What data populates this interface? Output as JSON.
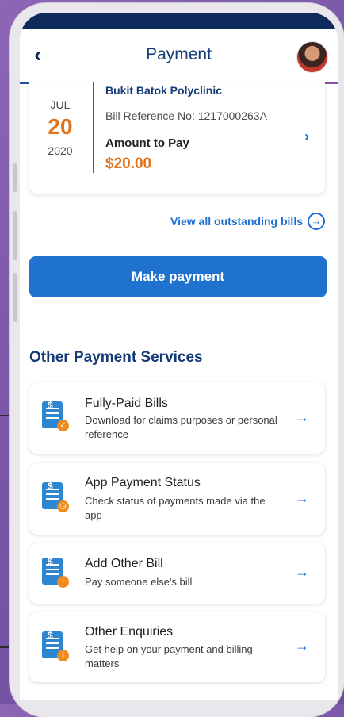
{
  "header": {
    "title": "Payment"
  },
  "bill": {
    "clinic": "Bukit Batok Polyclinic",
    "reference": "Bill Reference No: 1217000263A",
    "amount_label": "Amount to Pay",
    "amount": "$20.00",
    "month": "JUL",
    "day": "20",
    "year": "2020"
  },
  "view_all_label": "View all outstanding bills",
  "make_payment_label": "Make payment",
  "section_title": "Other Payment Services",
  "services": [
    {
      "title": "Fully-Paid Bills",
      "desc": "Download for claims purposes or personal reference",
      "icon": "receipt-check-icon"
    },
    {
      "title": "App Payment Status",
      "desc": "Check status of payments made via the app",
      "icon": "receipt-clock-icon"
    },
    {
      "title": "Add Other Bill",
      "desc": "Pay someone else's bill",
      "icon": "receipt-add-icon"
    },
    {
      "title": "Other Enquiries",
      "desc": "Get help on your payment and billing matters",
      "icon": "receipt-info-icon"
    }
  ],
  "colors": {
    "primary": "#1f72cd",
    "navy": "#143a78",
    "accent_orange": "#e0731c",
    "divider_red": "#c8302f"
  }
}
